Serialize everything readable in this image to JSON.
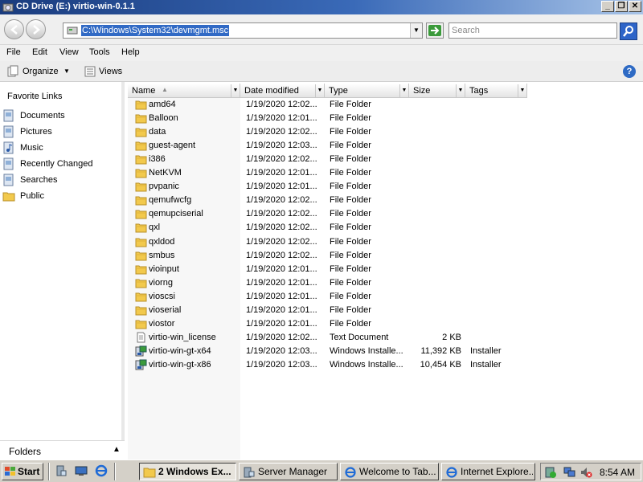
{
  "window": {
    "title": "CD Drive (E:) virtio-win-0.1.1",
    "address": "C:\\Windows\\System32\\devmgmt.msc",
    "search_placeholder": "Search"
  },
  "menu": [
    "File",
    "Edit",
    "View",
    "Tools",
    "Help"
  ],
  "toolbar": {
    "organize": "Organize",
    "views": "Views"
  },
  "nav": {
    "favorites_title": "Favorite Links",
    "items": [
      {
        "label": "Documents",
        "icon": "documents-icon"
      },
      {
        "label": "Pictures",
        "icon": "pictures-icon"
      },
      {
        "label": "Music",
        "icon": "music-icon"
      },
      {
        "label": "Recently Changed",
        "icon": "recently-changed-icon"
      },
      {
        "label": "Searches",
        "icon": "searches-icon"
      },
      {
        "label": "Public",
        "icon": "folder-icon"
      }
    ],
    "folders_label": "Folders"
  },
  "columns": [
    "Name",
    "Date modified",
    "Type",
    "Size",
    "Tags"
  ],
  "files": [
    {
      "name": "amd64",
      "date": "1/19/2020 12:02...",
      "type": "File Folder",
      "size": "",
      "tags": "",
      "icon": "folder"
    },
    {
      "name": "Balloon",
      "date": "1/19/2020 12:01...",
      "type": "File Folder",
      "size": "",
      "tags": "",
      "icon": "folder"
    },
    {
      "name": "data",
      "date": "1/19/2020 12:02...",
      "type": "File Folder",
      "size": "",
      "tags": "",
      "icon": "folder"
    },
    {
      "name": "guest-agent",
      "date": "1/19/2020 12:03...",
      "type": "File Folder",
      "size": "",
      "tags": "",
      "icon": "folder"
    },
    {
      "name": "i386",
      "date": "1/19/2020 12:02...",
      "type": "File Folder",
      "size": "",
      "tags": "",
      "icon": "folder"
    },
    {
      "name": "NetKVM",
      "date": "1/19/2020 12:01...",
      "type": "File Folder",
      "size": "",
      "tags": "",
      "icon": "folder"
    },
    {
      "name": "pvpanic",
      "date": "1/19/2020 12:01...",
      "type": "File Folder",
      "size": "",
      "tags": "",
      "icon": "folder"
    },
    {
      "name": "qemufwcfg",
      "date": "1/19/2020 12:02...",
      "type": "File Folder",
      "size": "",
      "tags": "",
      "icon": "folder"
    },
    {
      "name": "qemupciserial",
      "date": "1/19/2020 12:02...",
      "type": "File Folder",
      "size": "",
      "tags": "",
      "icon": "folder"
    },
    {
      "name": "qxl",
      "date": "1/19/2020 12:02...",
      "type": "File Folder",
      "size": "",
      "tags": "",
      "icon": "folder"
    },
    {
      "name": "qxldod",
      "date": "1/19/2020 12:02...",
      "type": "File Folder",
      "size": "",
      "tags": "",
      "icon": "folder"
    },
    {
      "name": "smbus",
      "date": "1/19/2020 12:02...",
      "type": "File Folder",
      "size": "",
      "tags": "",
      "icon": "folder"
    },
    {
      "name": "vioinput",
      "date": "1/19/2020 12:01...",
      "type": "File Folder",
      "size": "",
      "tags": "",
      "icon": "folder"
    },
    {
      "name": "viorng",
      "date": "1/19/2020 12:01...",
      "type": "File Folder",
      "size": "",
      "tags": "",
      "icon": "folder"
    },
    {
      "name": "vioscsi",
      "date": "1/19/2020 12:01...",
      "type": "File Folder",
      "size": "",
      "tags": "",
      "icon": "folder"
    },
    {
      "name": "vioserial",
      "date": "1/19/2020 12:01...",
      "type": "File Folder",
      "size": "",
      "tags": "",
      "icon": "folder"
    },
    {
      "name": "viostor",
      "date": "1/19/2020 12:01...",
      "type": "File Folder",
      "size": "",
      "tags": "",
      "icon": "folder"
    },
    {
      "name": "virtio-win_license",
      "date": "1/19/2020 12:02...",
      "type": "Text Document",
      "size": "2 KB",
      "tags": "",
      "icon": "text"
    },
    {
      "name": "virtio-win-gt-x64",
      "date": "1/19/2020 12:03...",
      "type": "Windows Installe...",
      "size": "11,392 KB",
      "tags": "Installer",
      "icon": "msi"
    },
    {
      "name": "virtio-win-gt-x86",
      "date": "1/19/2020 12:03...",
      "type": "Windows Installe...",
      "size": "10,454 KB",
      "tags": "Installer",
      "icon": "msi"
    }
  ],
  "taskbar": {
    "start": "Start",
    "buttons": [
      {
        "label": "2 Windows Ex...",
        "active": true,
        "icon": "folder-icon"
      },
      {
        "label": "Server Manager",
        "active": false,
        "icon": "server-manager-icon"
      },
      {
        "label": "Welcome to Tab...",
        "active": false,
        "icon": "browser-icon"
      },
      {
        "label": "Internet Explore...",
        "active": false,
        "icon": "internet-explorer-icon"
      }
    ],
    "clock": "8:54 AM"
  },
  "colors": {
    "title_bar": "#1a3c7e",
    "selection": "#316ac5",
    "folder": "#f2c94c",
    "taskbar": "#d4d0c8"
  }
}
